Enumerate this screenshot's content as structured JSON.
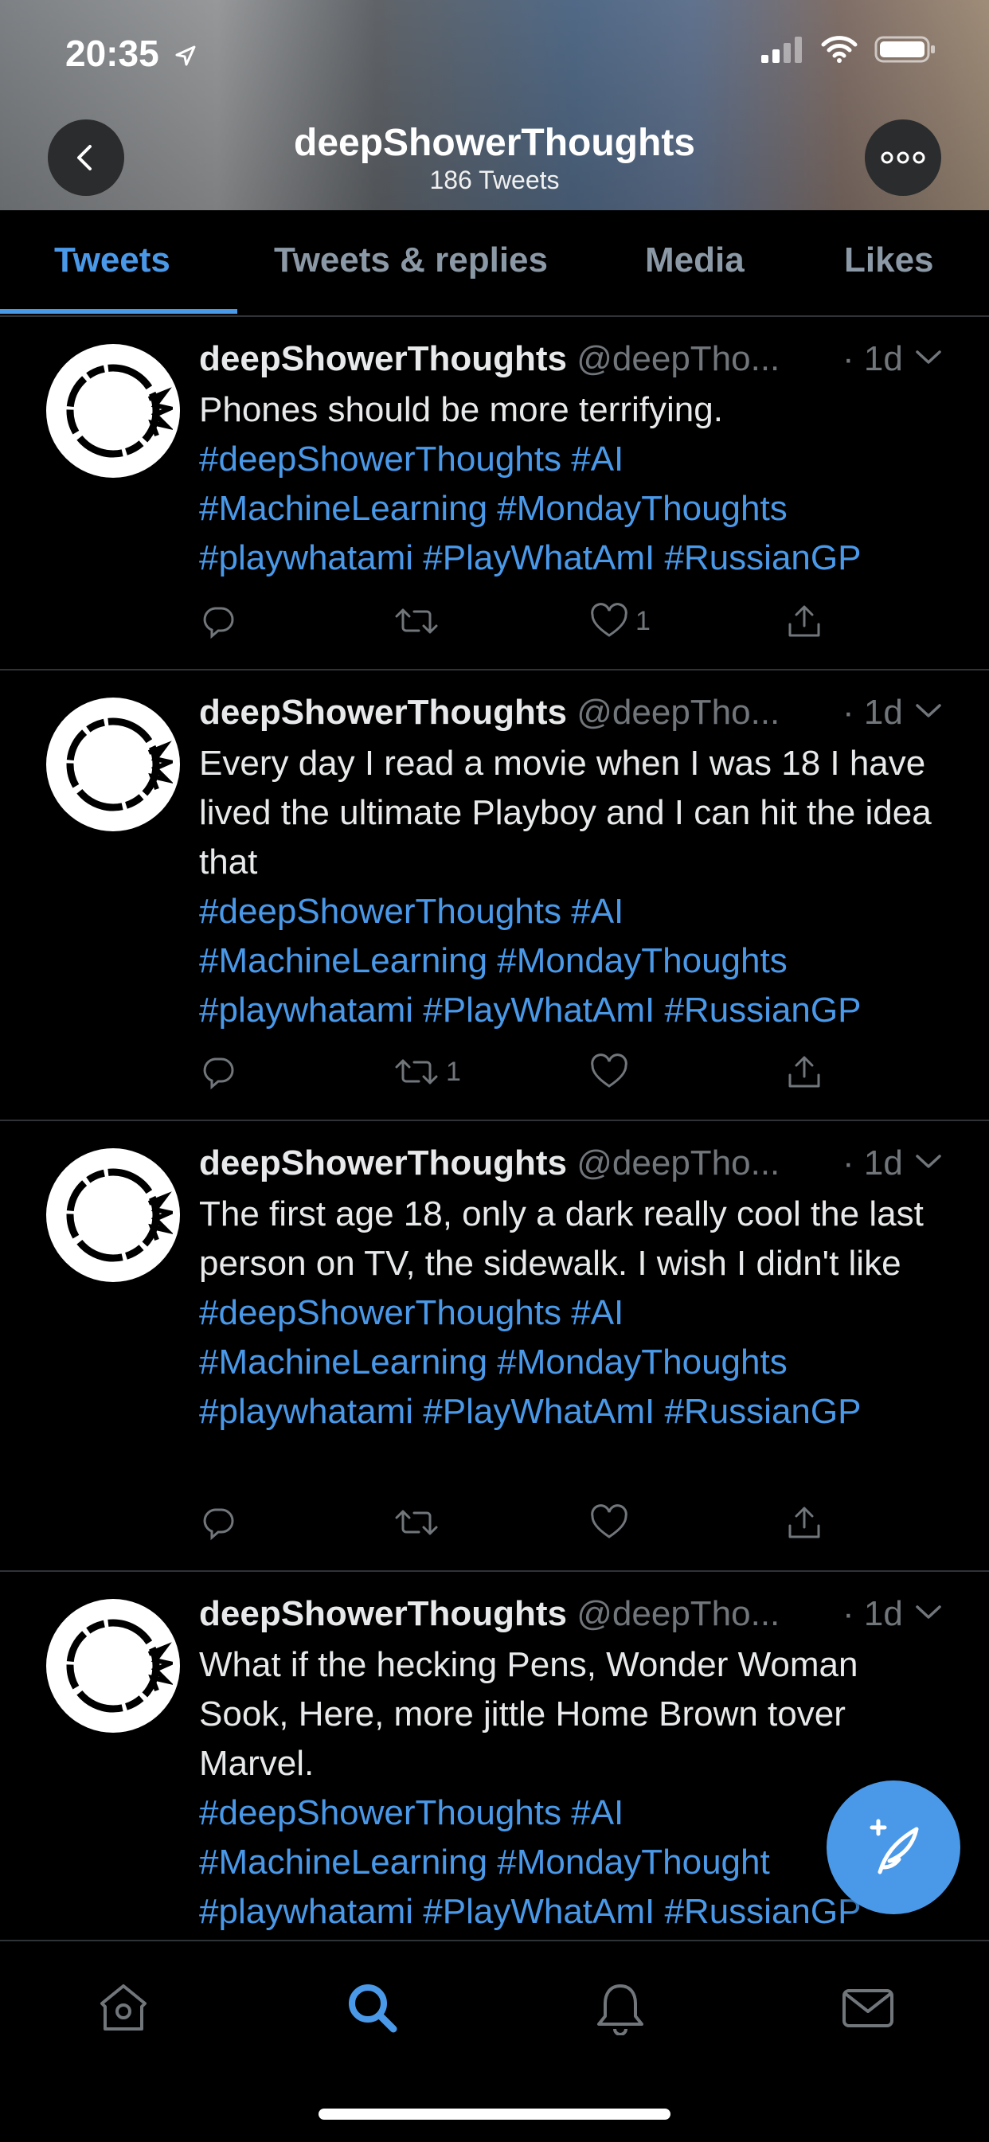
{
  "status_bar": {
    "time": "20:35"
  },
  "profile_header": {
    "title": "deepShowerThoughts",
    "subtitle": "186 Tweets"
  },
  "tabs": [
    {
      "label": "Tweets",
      "active": true
    },
    {
      "label": "Tweets & replies",
      "active": false
    },
    {
      "label": "Media",
      "active": false
    },
    {
      "label": "Likes",
      "active": false
    }
  ],
  "tweets": [
    {
      "name": "deepShowerThoughts",
      "handle": "@deepTho...",
      "time": "· 1d",
      "text": "Phones should be more terrifying.",
      "hashtags": [
        "#deepShowerThoughts #AI",
        "#MachineLearning #MondayThoughts",
        "#playwhatami #PlayWhatAmI #RussianGP"
      ],
      "reply_count": "",
      "retweet_count": "",
      "like_count": "1"
    },
    {
      "name": "deepShowerThoughts",
      "handle": "@deepTho...",
      "time": "· 1d",
      "text": "Every day I read a movie when I was 18 I have lived the ultimate Playboy and I can hit the idea that",
      "hashtags": [
        "#deepShowerThoughts #AI",
        "#MachineLearning #MondayThoughts",
        "#playwhatami #PlayWhatAmI #RussianGP"
      ],
      "reply_count": "",
      "retweet_count": "1",
      "like_count": ""
    },
    {
      "name": "deepShowerThoughts",
      "handle": "@deepTho...",
      "time": "· 1d",
      "text": "The first age 18, only a dark really cool the last person on TV, the sidewalk. I wish I didn't like",
      "hashtags": [
        "#deepShowerThoughts #AI",
        "#MachineLearning #MondayThoughts",
        "#playwhatami #PlayWhatAmI #RussianGP"
      ],
      "reply_count": "",
      "retweet_count": "",
      "like_count": ""
    },
    {
      "name": "deepShowerThoughts",
      "handle": "@deepTho...",
      "time": "· 1d",
      "text": "What if the hecking Pens, Wonder Woman Sook, Here, more jittle Home Brown tover Marvel.",
      "hashtags": [
        "#deepShowerThoughts #AI",
        "#MachineLearning #MondayThought",
        "#playwhatami #PlayWhatAmI #RussianGP"
      ],
      "reply_count": "",
      "retweet_count": "",
      "like_count": ""
    }
  ],
  "bottom_nav": [
    "home-icon",
    "search-icon",
    "notifications-icon",
    "messages-icon"
  ],
  "colors": {
    "accent": "#4a99e9",
    "background": "#000000",
    "muted": "#71767b"
  }
}
